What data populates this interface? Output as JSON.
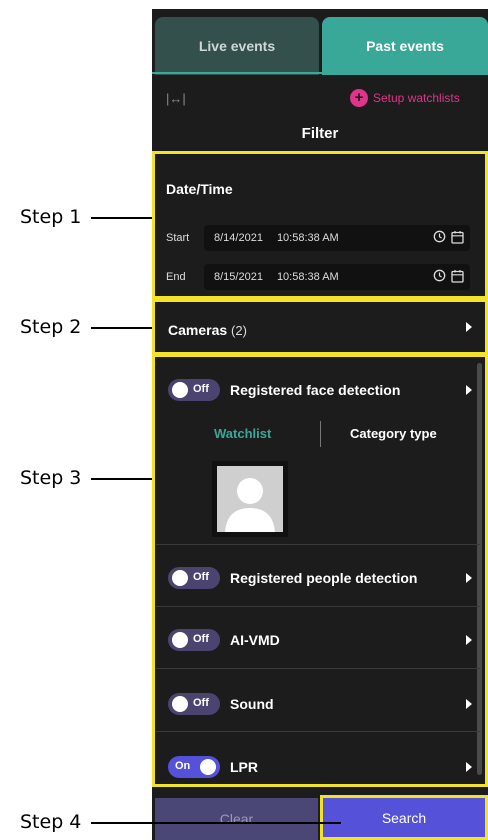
{
  "tabs": {
    "live": "Live events",
    "past": "Past events"
  },
  "toolbar": {
    "setup_watchlists": "Setup watchlists"
  },
  "filter": {
    "title": "Filter"
  },
  "datetime": {
    "title": "Date/Time",
    "start": {
      "label": "Start",
      "date": "8/14/2021",
      "time": "10:58:38 AM"
    },
    "end": {
      "label": "End",
      "date": "8/15/2021",
      "time": "10:58:38 AM"
    }
  },
  "cameras": {
    "label": "Cameras",
    "count": "(2)"
  },
  "detections": [
    {
      "label": "Registered face detection",
      "toggle": "Off",
      "enabled": false
    },
    {
      "label": "Registered people detection",
      "toggle": "Off",
      "enabled": false
    },
    {
      "label": "AI-VMD",
      "toggle": "Off",
      "enabled": false
    },
    {
      "label": "Sound",
      "toggle": "Off",
      "enabled": false
    },
    {
      "label": "LPR",
      "toggle": "On",
      "enabled": true
    }
  ],
  "face_subtabs": {
    "watchlist": "Watchlist",
    "category": "Category type"
  },
  "buttons": {
    "clear": "Clear",
    "search": "Search"
  },
  "steps": [
    "Step 1",
    "Step 2",
    "Step 3",
    "Step 4"
  ],
  "colors": {
    "accent_teal": "#3aa898",
    "accent_purple": "#5551d9",
    "highlight_yellow": "#f2e22a",
    "pink": "#e0338a"
  }
}
